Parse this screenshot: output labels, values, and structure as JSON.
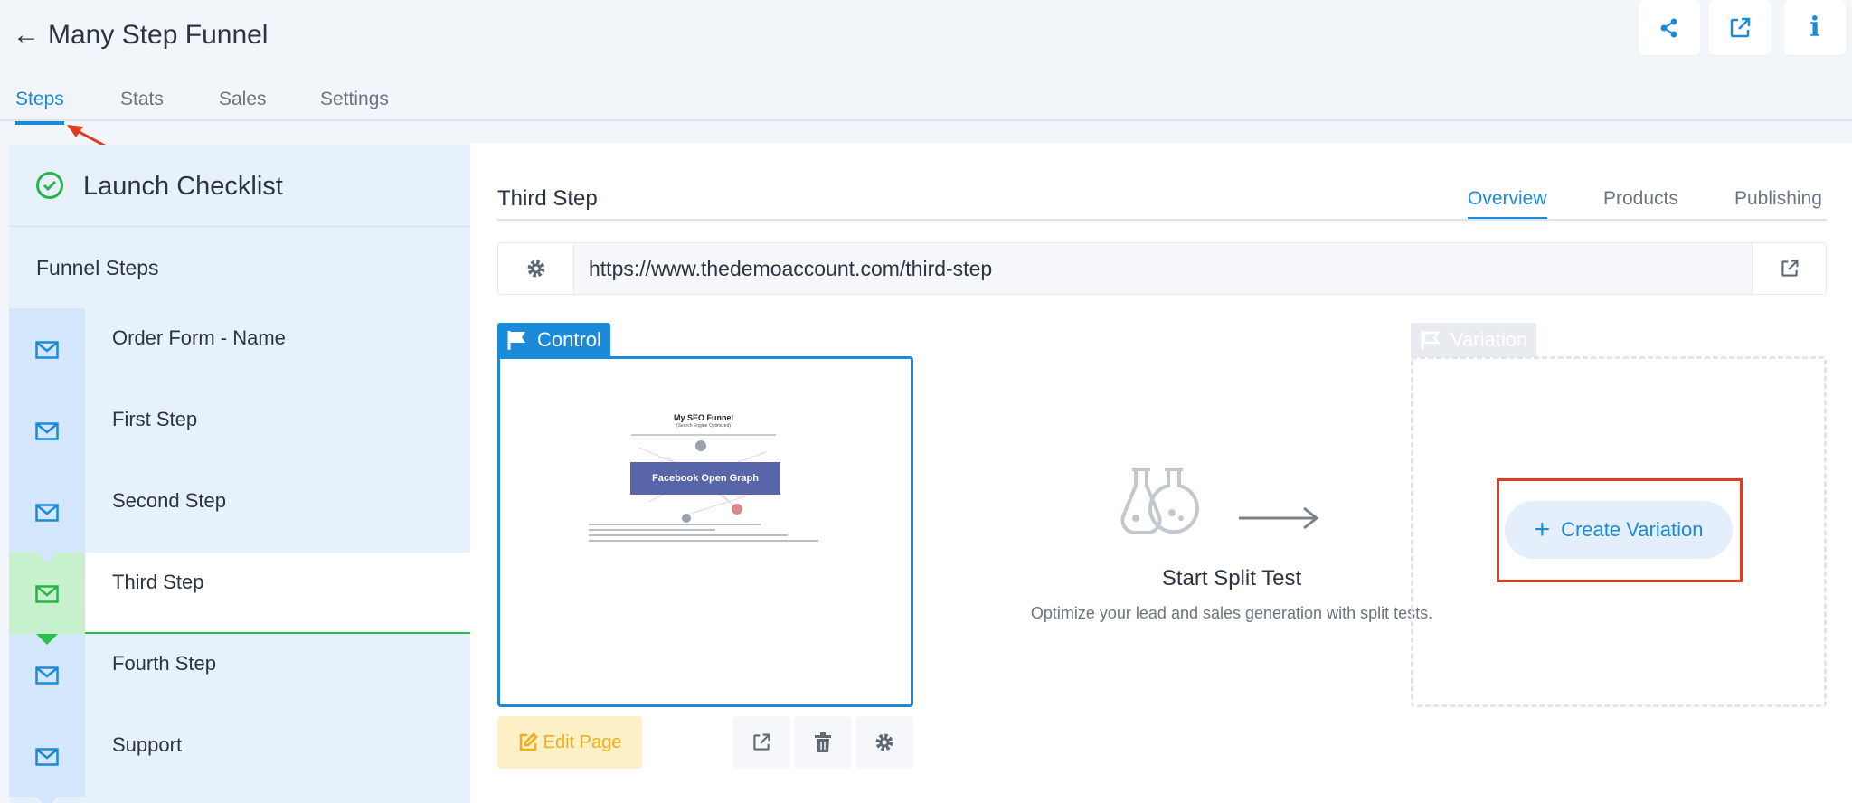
{
  "header": {
    "back_icon": "←",
    "title": "Many Step Funnel",
    "actions": [
      {
        "name": "share-icon"
      },
      {
        "name": "external-link-icon"
      },
      {
        "name": "info-icon",
        "glyph": "i"
      }
    ]
  },
  "nav": {
    "tabs": [
      {
        "label": "Steps",
        "active": true
      },
      {
        "label": "Stats"
      },
      {
        "label": "Sales"
      },
      {
        "label": "Settings"
      }
    ]
  },
  "sidebar": {
    "checklist_label": "Launch Checklist",
    "section_label": "Funnel Steps",
    "steps": [
      {
        "label": "Order Form - Name"
      },
      {
        "label": "First Step"
      },
      {
        "label": "Second Step"
      },
      {
        "label": "Third Step",
        "active": true
      },
      {
        "label": "Fourth Step"
      },
      {
        "label": "Support"
      }
    ]
  },
  "main": {
    "step_title": "Third Step",
    "tabs": [
      {
        "label": "Overview",
        "active": true
      },
      {
        "label": "Products"
      },
      {
        "label": "Publishing"
      }
    ],
    "url": "https://www.thedemoaccount.com/third-step",
    "control": {
      "label": "Control",
      "thumbnail": {
        "title": "My SEO Funnel",
        "subtitle": "(Search Engine Optimized)",
        "banner": "Facebook Open Graph"
      },
      "edit_label": "Edit Page"
    },
    "split_test": {
      "title": "Start Split Test",
      "description": "Optimize your lead and sales generation with split tests."
    },
    "variation": {
      "label": "Variation",
      "create_label": "Create Variation"
    }
  },
  "colors": {
    "accent": "#1b8ad8",
    "success": "#27b547",
    "annotation": "#e23a1e",
    "edit": "#f0ad1a"
  }
}
